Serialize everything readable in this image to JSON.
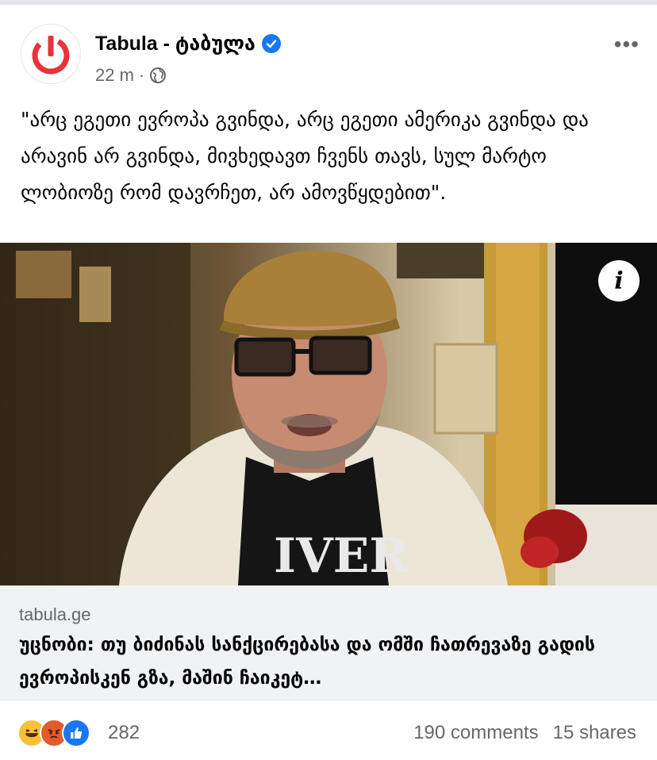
{
  "post": {
    "page_name": "Tabula - ტაბულა",
    "time": "22 m",
    "separator": "·",
    "text": "\"არც ეგეთი ევროპა გვინდა, არც ეგეთი ამერიკა გვინდა და არავინ არ გვინდა, მივხედავთ ჩვენს თავს, სულ მარტო ლობიოზე რომ დავრჩეთ, არ ამოვწყდებით\".",
    "privacy_icon": "globe-icon",
    "verified_icon": "verified-badge-icon",
    "more_label": "•••"
  },
  "link": {
    "domain": "tabula.ge",
    "headline": "უცნობი: თუ ბიძინას სანქცირებასა და ომში ჩათრევაზე გადის ევროპისკენ გზა, მაშინ ჩაიკეტ…",
    "info_label": "i"
  },
  "footer": {
    "reaction_count": "282",
    "comments": "190 comments",
    "shares": "15 shares",
    "reaction_icons": [
      "haha-icon",
      "angry-icon",
      "like-icon"
    ]
  },
  "colors": {
    "brand": "#e8333c",
    "verified": "#1877f2",
    "like": "#1877f2"
  }
}
